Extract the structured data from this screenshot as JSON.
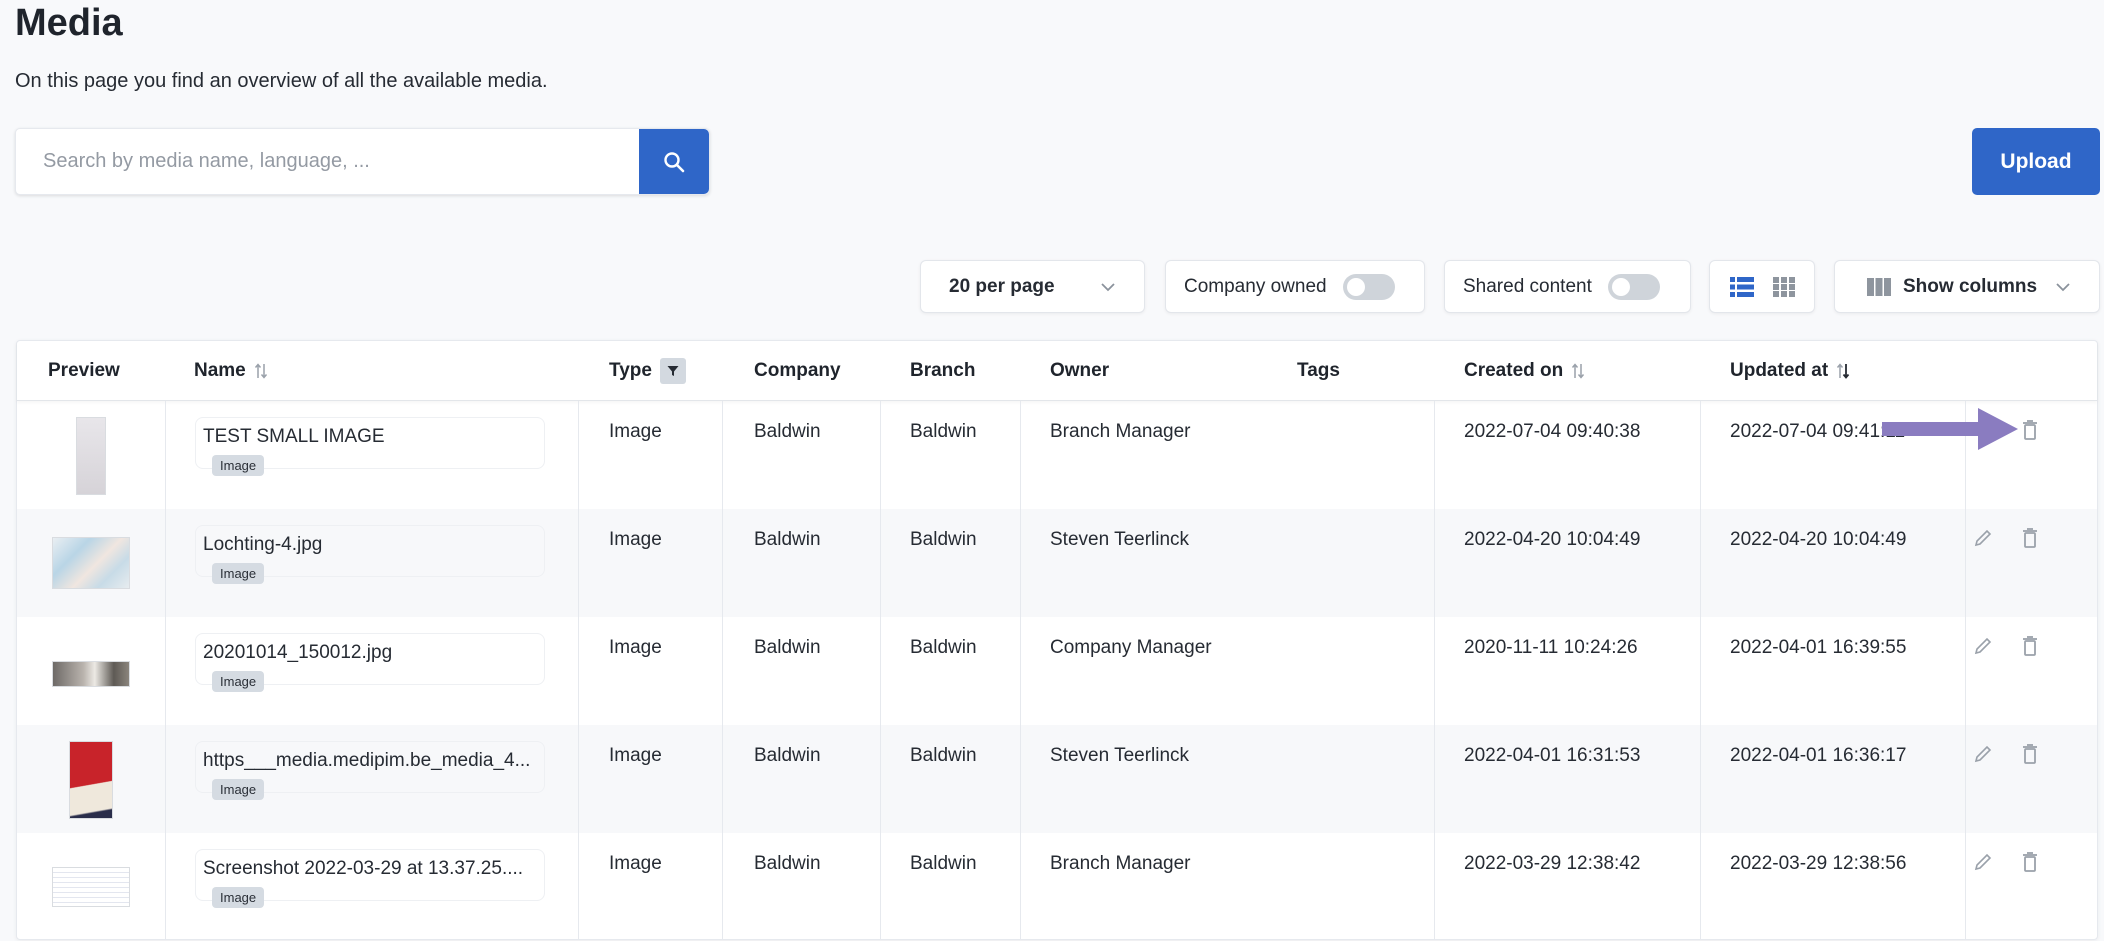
{
  "page": {
    "title": "Media",
    "subtitle": "On this page you find an overview of all the available media."
  },
  "search": {
    "placeholder": "Search by media name, language, ...",
    "value": "",
    "button_icon": "search-icon"
  },
  "upload": {
    "label": "Upload"
  },
  "toolbar": {
    "per_page": "20 per page",
    "company_owned": {
      "label": "Company owned",
      "on": false
    },
    "shared_content": {
      "label": "Shared content",
      "on": false
    },
    "view_mode": "list",
    "show_columns": "Show columns"
  },
  "colors": {
    "accent": "#2f66c8",
    "annotation_arrow": "#8a7cc0"
  },
  "table": {
    "columns": {
      "preview": "Preview",
      "name": "Name",
      "type": "Type",
      "company": "Company",
      "branch": "Branch",
      "owner": "Owner",
      "tags": "Tags",
      "created": "Created on",
      "updated": "Updated at"
    },
    "rows": [
      {
        "name": "TEST SMALL IMAGE",
        "chip": "Image",
        "type": "Image",
        "company": "Baldwin",
        "branch": "Baldwin",
        "owner": "Branch Manager",
        "tags": "",
        "created": "2022-07-04 09:40:38",
        "updated": "2022-07-04 09:41:11",
        "editable": false
      },
      {
        "name": "Lochting-4.jpg",
        "chip": "Image",
        "type": "Image",
        "company": "Baldwin",
        "branch": "Baldwin",
        "owner": "Steven Teerlinck",
        "tags": "",
        "created": "2022-04-20 10:04:49",
        "updated": "2022-04-20 10:04:49",
        "editable": true
      },
      {
        "name": "20201014_150012.jpg",
        "chip": "Image",
        "type": "Image",
        "company": "Baldwin",
        "branch": "Baldwin",
        "owner": "Company Manager",
        "tags": "",
        "created": "2020-11-11 10:24:26",
        "updated": "2022-04-01 16:39:55",
        "editable": true
      },
      {
        "name": "https___media.medipim.be_media_4...",
        "chip": "Image",
        "type": "Image",
        "company": "Baldwin",
        "branch": "Baldwin",
        "owner": "Steven Teerlinck",
        "tags": "",
        "created": "2022-04-01 16:31:53",
        "updated": "2022-04-01 16:36:17",
        "editable": true
      },
      {
        "name": "Screenshot 2022-03-29 at 13.37.25....",
        "chip": "Image",
        "type": "Image",
        "company": "Baldwin",
        "branch": "Baldwin",
        "owner": "Branch Manager",
        "tags": "",
        "created": "2022-03-29 12:38:42",
        "updated": "2022-03-29 12:38:56",
        "editable": true
      }
    ]
  }
}
